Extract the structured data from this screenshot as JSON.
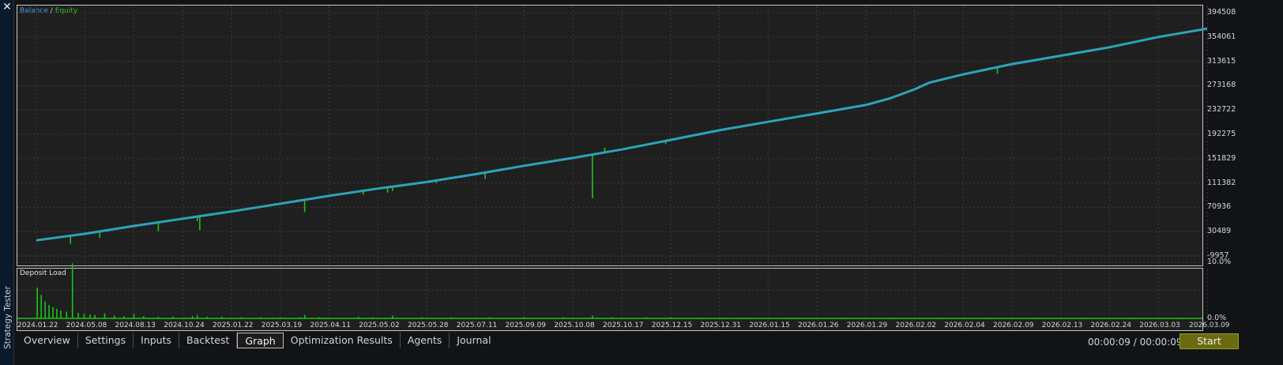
{
  "window": {
    "close_glyph": "✕",
    "side_title": "Strategy Tester"
  },
  "tabs": [
    {
      "label": "Overview",
      "active": false
    },
    {
      "label": "Settings",
      "active": false
    },
    {
      "label": "Inputs",
      "active": false
    },
    {
      "label": "Backtest",
      "active": false
    },
    {
      "label": "Graph",
      "active": true
    },
    {
      "label": "Optimization Results",
      "active": false
    },
    {
      "label": "Agents",
      "active": false
    },
    {
      "label": "Journal",
      "active": false
    }
  ],
  "footer": {
    "timer": "00:00:09 / 00:00:09",
    "start_label": "Start"
  },
  "colors": {
    "balance": "#2f9fd8",
    "equity": "#22c022",
    "deposit_load": "#18c418",
    "panel_bg": "#1f1f1f",
    "grid": "#3c3c3c",
    "start_button": "#6a6a10"
  },
  "chart_data": [
    {
      "type": "line",
      "legend": {
        "balance": "Balance",
        "separator": "/",
        "equity": "Equity"
      },
      "grid": true,
      "y_ticks": [
        "394508",
        "354061",
        "313615",
        "273168",
        "232722",
        "192275",
        "151829",
        "111382",
        "70936",
        "30489",
        "-9957"
      ],
      "ylim": [
        -9957,
        394508
      ],
      "x_ticks": [
        "2024.01.22",
        "2024.05.08",
        "2024.08.13",
        "2024.10.24",
        "2025.01.22",
        "2025.03.19",
        "2025.04.11",
        "2025.05.02",
        "2025.05.28",
        "2025.07.11",
        "2025.09.09",
        "2025.10.08",
        "2025.10.17",
        "2025.12.15",
        "2025.12.31",
        "2026.01.15",
        "2026.01.26",
        "2026.01.29",
        "2026.02.02",
        "2026.02.04",
        "2026.02.09",
        "2026.02.13",
        "2026.02.24",
        "2026.03.03",
        "2026.03.09"
      ],
      "series": [
        {
          "name": "Balance",
          "points": [
            [
              0,
              16000
            ],
            [
              1,
              27000
            ],
            [
              2,
              40000
            ],
            [
              3,
              52000
            ],
            [
              4,
              64000
            ],
            [
              5,
              77000
            ],
            [
              6,
              90000
            ],
            [
              7,
              102000
            ],
            [
              8,
              113000
            ],
            [
              9,
              126000
            ],
            [
              10,
              140000
            ],
            [
              11,
              153000
            ],
            [
              12,
              167000
            ],
            [
              13,
              183000
            ],
            [
              14,
              199000
            ],
            [
              15,
              213000
            ],
            [
              16,
              227000
            ],
            [
              17,
              241000
            ],
            [
              17.5,
              252000
            ],
            [
              18,
              267000
            ],
            [
              18.3,
              278000
            ],
            [
              19,
              292000
            ],
            [
              20,
              309000
            ],
            [
              21,
              323000
            ],
            [
              22,
              337000
            ],
            [
              23,
              354000
            ],
            [
              24,
              368000
            ]
          ]
        },
        {
          "name": "Equity",
          "drawdowns": [
            [
              0.7,
              10000
            ],
            [
              1.3,
              20000
            ],
            [
              2.5,
              31000
            ],
            [
              3.3,
              48000
            ],
            [
              3.35,
              33000
            ],
            [
              5.5,
              63000
            ],
            [
              6.7,
              92000
            ],
            [
              7.2,
              95000
            ],
            [
              7.3,
              98000
            ],
            [
              8.2,
              111000
            ],
            [
              8.3,
              115000
            ],
            [
              9.2,
              118000
            ],
            [
              11.4,
              86000
            ],
            [
              11.65,
              170000
            ],
            [
              12.9,
              176000
            ],
            [
              13.1,
              186000
            ],
            [
              19.7,
              293000
            ],
            [
              20.2,
              311000
            ]
          ]
        }
      ]
    },
    {
      "type": "bar",
      "title": "Deposit Load",
      "y_ticks": [
        "10.0%",
        "0.0%"
      ],
      "ylim": [
        0,
        10
      ],
      "x_range": [
        0,
        24
      ],
      "spikes": [
        [
          0.02,
          5.5
        ],
        [
          0.1,
          4.2
        ],
        [
          0.18,
          3.0
        ],
        [
          0.26,
          2.4
        ],
        [
          0.34,
          2.0
        ],
        [
          0.42,
          1.7
        ],
        [
          0.5,
          1.4
        ],
        [
          0.62,
          1.2
        ],
        [
          0.74,
          9.8
        ],
        [
          0.86,
          1.0
        ],
        [
          0.98,
          0.8
        ],
        [
          1.1,
          0.7
        ],
        [
          1.2,
          0.6
        ],
        [
          1.4,
          0.9
        ],
        [
          1.6,
          0.5
        ],
        [
          1.8,
          0.4
        ],
        [
          2.0,
          0.8
        ],
        [
          2.2,
          0.4
        ],
        [
          2.5,
          0.3
        ],
        [
          2.8,
          0.3
        ],
        [
          3.2,
          0.4
        ],
        [
          3.3,
          0.6
        ],
        [
          3.5,
          0.3
        ],
        [
          3.8,
          0.3
        ],
        [
          4.2,
          0.2
        ],
        [
          4.6,
          0.2
        ],
        [
          5.0,
          0.2
        ],
        [
          5.4,
          0.2
        ],
        [
          5.5,
          0.6
        ],
        [
          5.8,
          0.2
        ],
        [
          6.6,
          0.3
        ],
        [
          6.9,
          0.2
        ],
        [
          7.3,
          0.5
        ],
        [
          7.9,
          0.2
        ],
        [
          8.5,
          0.2
        ],
        [
          9.3,
          0.2
        ],
        [
          10.0,
          0.2
        ],
        [
          10.8,
          0.2
        ],
        [
          11.4,
          0.5
        ],
        [
          11.8,
          0.2
        ],
        [
          12.5,
          0.2
        ],
        [
          13.0,
          0.2
        ],
        [
          13.6,
          0.1
        ],
        [
          14.5,
          0.1
        ],
        [
          15.5,
          0.1
        ],
        [
          16.5,
          0.1
        ],
        [
          17.5,
          0.1
        ],
        [
          18.5,
          0.1
        ],
        [
          19.5,
          0.1
        ],
        [
          20.5,
          0.1
        ],
        [
          21.5,
          0.1
        ],
        [
          22.5,
          0.1
        ],
        [
          23.5,
          0.1
        ]
      ]
    }
  ]
}
